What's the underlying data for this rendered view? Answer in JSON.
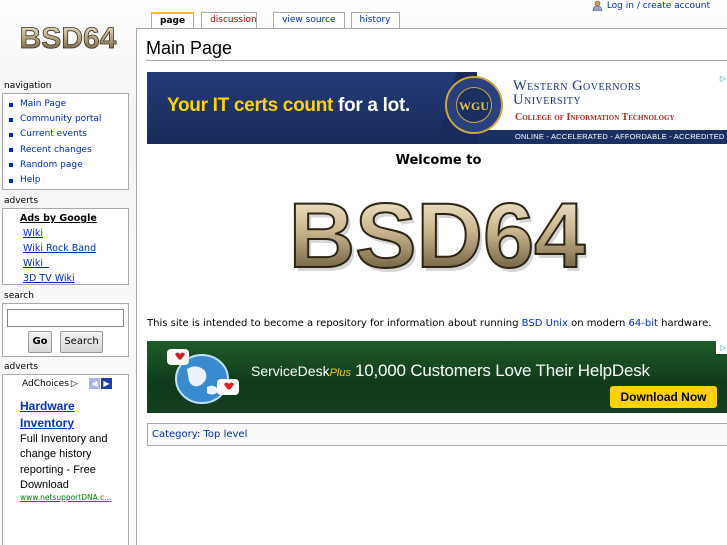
{
  "site": {
    "logo_text": "BSD64"
  },
  "personal": {
    "login_label": "Log in / create account"
  },
  "tabs": [
    {
      "label": "page"
    },
    {
      "label": "discussion"
    },
    {
      "label": "view source"
    },
    {
      "label": "history"
    }
  ],
  "page": {
    "title": "Main Page",
    "welcome": "Welcome to",
    "big_logo_text": "BSD64",
    "intro": {
      "before": "This site is intended to become a repository for information about running ",
      "link1": "BSD Unix",
      "middle": " on modern ",
      "link2": "64-bit",
      "after": " hardware."
    },
    "category_label": "Category",
    "category_sep": ": ",
    "category_value": "Top level"
  },
  "banner1": {
    "headline_a": "Your IT certs count ",
    "headline_b": "for a lot.",
    "seal": "WGU",
    "name_line1": "Western Governors",
    "name_line2": "University",
    "college": "College of Information Technology",
    "tagline": "ONLINE - ACCELERATED - AFFORDABLE - ACCREDITED",
    "adchoice": "▷"
  },
  "banner2": {
    "brand_a": "ServiceDesk",
    "brand_b": "Plus",
    "headline": "10,000 Customers Love Their HelpDesk",
    "button": "Download Now",
    "adchoice": "▷"
  },
  "sidebar": {
    "navigation_title": "navigation",
    "nav_items": [
      {
        "label": "Main Page"
      },
      {
        "label": "Community portal"
      },
      {
        "label": "Current events"
      },
      {
        "label": "Recent changes"
      },
      {
        "label": "Random page"
      },
      {
        "label": "Help"
      }
    ],
    "adverts_title": "adverts",
    "ads_by": "Ads by Google",
    "ad_links": [
      {
        "label": "Wiki"
      },
      {
        "label": "Wiki Rock Band"
      },
      {
        "label": "Wiki  "
      },
      {
        "label": "3D TV Wiki"
      }
    ],
    "search_title": "search",
    "search_value": "",
    "go_label": "Go",
    "search_label": "Search",
    "adverts2_title": "adverts",
    "adchoices_label": "AdChoices",
    "adchoices_icon": "▷",
    "arrow_prev": "◀",
    "arrow_next": "▶",
    "ad2_title": "Hardware Inventory",
    "ad2_text": "Full Inventory and change history reporting - Free Download",
    "ad2_url": "www.netsupportDNA.c..."
  },
  "colors": {
    "link": "#002bb8",
    "new_link": "#ba0000",
    "tab_accent": "#fabd23",
    "ad_title": "#0033cc",
    "ad_url": "#008000",
    "button_yellow": "#ffd200"
  }
}
